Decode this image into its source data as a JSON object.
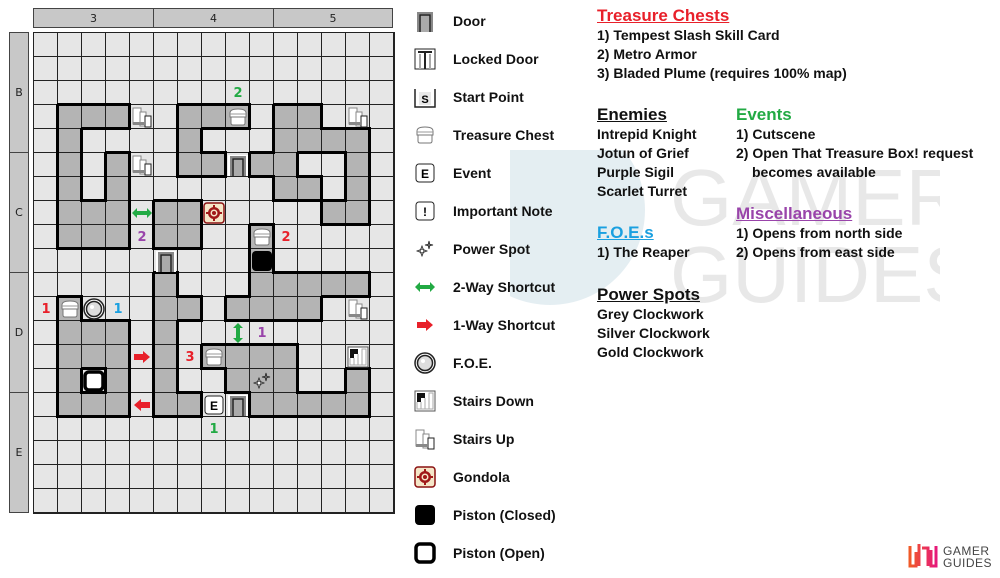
{
  "map": {
    "column_headers": [
      "3",
      "4",
      "5"
    ],
    "row_headers": [
      "B",
      "C",
      "D",
      "E"
    ],
    "cols": 15,
    "rows": 20,
    "shaded": [
      [
        3,
        1
      ],
      [
        3,
        2
      ],
      [
        3,
        3
      ],
      [
        3,
        6
      ],
      [
        3,
        7
      ],
      [
        3,
        8
      ],
      [
        3,
        10
      ],
      [
        3,
        11
      ],
      [
        4,
        1
      ],
      [
        4,
        6
      ],
      [
        4,
        10
      ],
      [
        4,
        11
      ],
      [
        4,
        12
      ],
      [
        4,
        13
      ],
      [
        5,
        1
      ],
      [
        5,
        3
      ],
      [
        5,
        6
      ],
      [
        5,
        7
      ],
      [
        5,
        9
      ],
      [
        5,
        10
      ],
      [
        5,
        13
      ],
      [
        6,
        1
      ],
      [
        6,
        3
      ],
      [
        6,
        10
      ],
      [
        6,
        11
      ],
      [
        6,
        13
      ],
      [
        7,
        1
      ],
      [
        7,
        2
      ],
      [
        7,
        3
      ],
      [
        7,
        5
      ],
      [
        7,
        6
      ],
      [
        7,
        12
      ],
      [
        7,
        13
      ],
      [
        8,
        1
      ],
      [
        8,
        2
      ],
      [
        8,
        3
      ],
      [
        8,
        5
      ],
      [
        8,
        6
      ],
      [
        8,
        9
      ],
      [
        9,
        9
      ],
      [
        10,
        5
      ],
      [
        10,
        9
      ],
      [
        10,
        10
      ],
      [
        10,
        11
      ],
      [
        10,
        12
      ],
      [
        10,
        13
      ],
      [
        11,
        1
      ],
      [
        11,
        5
      ],
      [
        11,
        6
      ],
      [
        11,
        8
      ],
      [
        11,
        9
      ],
      [
        11,
        10
      ],
      [
        11,
        11
      ],
      [
        12,
        1
      ],
      [
        12,
        2
      ],
      [
        12,
        3
      ],
      [
        12,
        5
      ],
      [
        13,
        1
      ],
      [
        13,
        2
      ],
      [
        13,
        3
      ],
      [
        13,
        5
      ],
      [
        13,
        7
      ],
      [
        13,
        8
      ],
      [
        13,
        9
      ],
      [
        13,
        10
      ],
      [
        14,
        1
      ],
      [
        14,
        3
      ],
      [
        14,
        5
      ],
      [
        14,
        8
      ],
      [
        14,
        9
      ],
      [
        14,
        10
      ],
      [
        14,
        13
      ],
      [
        15,
        1
      ],
      [
        15,
        2
      ],
      [
        15,
        3
      ],
      [
        15,
        5
      ],
      [
        15,
        6
      ],
      [
        15,
        9
      ],
      [
        15,
        10
      ],
      [
        15,
        11
      ],
      [
        15,
        12
      ],
      [
        15,
        13
      ]
    ],
    "markers": [
      {
        "row": 2,
        "col": 8,
        "type": "label",
        "text": "2",
        "color": "#22aa44"
      },
      {
        "row": 3,
        "col": 4,
        "type": "stairs-up"
      },
      {
        "row": 3,
        "col": 8,
        "type": "chest"
      },
      {
        "row": 3,
        "col": 13,
        "type": "stairs-up"
      },
      {
        "row": 5,
        "col": 4,
        "type": "stairs-up"
      },
      {
        "row": 5,
        "col": 8,
        "type": "door"
      },
      {
        "row": 7,
        "col": 4,
        "type": "arrow-2way-h"
      },
      {
        "row": 7,
        "col": 7,
        "type": "gondola"
      },
      {
        "row": 8,
        "col": 4,
        "type": "label",
        "text": "2",
        "color": "#9944aa"
      },
      {
        "row": 8,
        "col": 9,
        "type": "chest"
      },
      {
        "row": 8,
        "col": 10,
        "type": "label",
        "text": "2",
        "color": "#e8202a"
      },
      {
        "row": 9,
        "col": 5,
        "type": "door"
      },
      {
        "row": 9,
        "col": 9,
        "type": "piston-closed"
      },
      {
        "row": 11,
        "col": 0,
        "type": "label",
        "text": "1",
        "color": "#e8202a"
      },
      {
        "row": 11,
        "col": 1,
        "type": "chest"
      },
      {
        "row": 11,
        "col": 2,
        "type": "foe"
      },
      {
        "row": 11,
        "col": 3,
        "type": "label",
        "text": "1",
        "color": "#1aa0e0"
      },
      {
        "row": 11,
        "col": 13,
        "type": "stairs-up"
      },
      {
        "row": 12,
        "col": 8,
        "type": "arrow-2way-v"
      },
      {
        "row": 12,
        "col": 9,
        "type": "label",
        "text": "1",
        "color": "#9944aa"
      },
      {
        "row": 13,
        "col": 4,
        "type": "arrow-right"
      },
      {
        "row": 13,
        "col": 6,
        "type": "label",
        "text": "3",
        "color": "#e8202a"
      },
      {
        "row": 13,
        "col": 7,
        "type": "chest"
      },
      {
        "row": 13,
        "col": 13,
        "type": "stairs-down"
      },
      {
        "row": 14,
        "col": 2,
        "type": "piston-open"
      },
      {
        "row": 14,
        "col": 9,
        "type": "power-spot"
      },
      {
        "row": 15,
        "col": 4,
        "type": "arrow-left"
      },
      {
        "row": 15,
        "col": 7,
        "type": "event"
      },
      {
        "row": 15,
        "col": 8,
        "type": "door"
      },
      {
        "row": 16,
        "col": 7,
        "type": "label",
        "text": "1",
        "color": "#22aa44"
      }
    ]
  },
  "legend": [
    {
      "icon": "door",
      "label": "Door"
    },
    {
      "icon": "locked-door",
      "label": "Locked Door"
    },
    {
      "icon": "start-point",
      "label": "Start Point"
    },
    {
      "icon": "chest",
      "label": "Treasure Chest"
    },
    {
      "icon": "event",
      "label": "Event"
    },
    {
      "icon": "important-note",
      "label": "Important Note"
    },
    {
      "icon": "power-spot",
      "label": "Power Spot"
    },
    {
      "icon": "arrow-2way-h",
      "label": "2-Way Shortcut"
    },
    {
      "icon": "arrow-right",
      "label": "1-Way Shortcut"
    },
    {
      "icon": "foe",
      "label": "F.O.E."
    },
    {
      "icon": "stairs-down",
      "label": "Stairs Down"
    },
    {
      "icon": "stairs-up",
      "label": "Stairs Up"
    },
    {
      "icon": "gondola",
      "label": "Gondola"
    },
    {
      "icon": "piston-closed",
      "label": "Piston (Closed)"
    },
    {
      "icon": "piston-open",
      "label": "Piston (Open)"
    }
  ],
  "sections": {
    "treasure": {
      "title": "Treasure Chests",
      "color": "#e8202a",
      "items": [
        "1) Tempest Slash Skill Card",
        "2) Metro Armor",
        "3) Bladed Plume (requires 100% map)"
      ]
    },
    "enemies": {
      "title": "Enemies",
      "color": "#111111",
      "items": [
        "Intrepid Knight",
        "Jotun of Grief",
        "Purple Sigil",
        "Scarlet Turret"
      ]
    },
    "foes": {
      "title": "F.O.E.s",
      "color": "#1aa0e0",
      "items": [
        "1) The Reaper"
      ]
    },
    "power_spots": {
      "title": "Power Spots",
      "color": "#111111",
      "items": [
        "Grey Clockwork",
        "Silver Clockwork",
        "Gold Clockwork"
      ]
    },
    "events": {
      "title": "Events",
      "color": "#22aa44",
      "items": [
        "1) Cutscene",
        "2) Open That Treasure Box! request",
        "    becomes available"
      ]
    },
    "misc": {
      "title": "Miscellaneous",
      "color": "#9944aa",
      "items": [
        "1) Opens from north side",
        "2) Opens from east side"
      ]
    }
  },
  "watermark": {
    "line1": "GAMER",
    "line2": "GUIDES"
  },
  "logo": {
    "line1": "GAMER",
    "line2": "GUIDES"
  }
}
